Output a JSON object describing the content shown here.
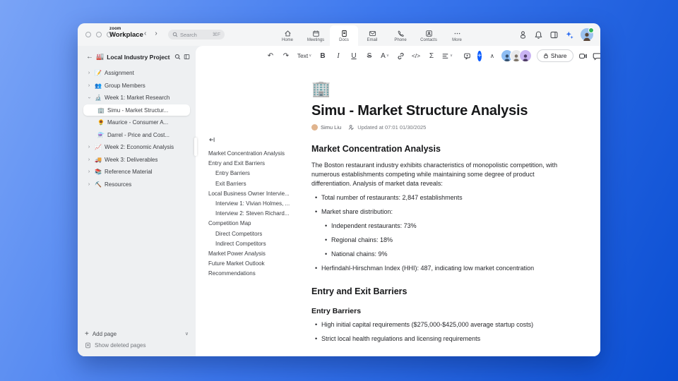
{
  "chrome": {
    "brand_top": "zoom",
    "brand_bottom": "Workplace",
    "back_glyph": "‹",
    "forward_glyph": "›",
    "search_placeholder": "Search",
    "search_shortcut": "⌘F",
    "tabs": [
      {
        "label": "Home"
      },
      {
        "label": "Meetings"
      },
      {
        "label": "Docs"
      },
      {
        "label": "Email"
      },
      {
        "label": "Phone"
      },
      {
        "label": "Contacts"
      },
      {
        "label": "More"
      }
    ]
  },
  "sidebar": {
    "project_icon": "🏭",
    "project_title": "Local Industry Project",
    "items": [
      {
        "icon": "📝",
        "label": "Assignment"
      },
      {
        "icon": "👥",
        "label": "Group Members"
      },
      {
        "icon": "🔬",
        "label": "Week 1: Market Research"
      },
      {
        "icon": "🏢",
        "label": "Simu - Market Structur..."
      },
      {
        "icon": "🌻",
        "label": "Maurice - Consumer A..."
      },
      {
        "icon": "⚗️",
        "label": "Darrel - Price and Cost..."
      },
      {
        "icon": "📈",
        "label": "Week 2: Economic Analysis"
      },
      {
        "icon": "🚚",
        "label": "Week 3: Deliverables"
      },
      {
        "icon": "📚",
        "label": "Reference Material"
      },
      {
        "icon": "⛏️",
        "label": "Resources"
      }
    ],
    "add_page": "Add page",
    "show_deleted": "Show deleted pages"
  },
  "toolbar": {
    "undo_glyph": "↶",
    "redo_glyph": "↷",
    "style_selector": "Text",
    "bold": "B",
    "italic": "I",
    "underline": "U",
    "strike": "S",
    "text_color": "A",
    "code_glyph": "</>",
    "formula_glyph": "Σ",
    "collapse_glyph": "∧",
    "share_label": "Share"
  },
  "outline": {
    "items": [
      {
        "label": "Market Concentration Analysis",
        "level": 1
      },
      {
        "label": "Entry and Exit Barriers",
        "level": 1
      },
      {
        "label": "Entry Barriers",
        "level": 2
      },
      {
        "label": "Exit Barriers",
        "level": 2
      },
      {
        "label": "Local Business Owner Intervie...",
        "level": 1
      },
      {
        "label": "Interview 1: Vivian Holmes, ...",
        "level": 2
      },
      {
        "label": "Interview 2: Steven Richard...",
        "level": 2
      },
      {
        "label": "Competition Map",
        "level": 1
      },
      {
        "label": "Direct Competitors",
        "level": 2
      },
      {
        "label": "Indirect Competitors",
        "level": 2
      },
      {
        "label": "Market Power Analysis",
        "level": 1
      },
      {
        "label": "Future Market Outlook",
        "level": 1
      },
      {
        "label": "Recommendations",
        "level": 1
      }
    ]
  },
  "document": {
    "icon": "🏢",
    "title": "Simu - Market Structure Analysis",
    "author": "Simu Liu",
    "updated": "Updated at 07:01 01/30/2025",
    "blocks": [
      {
        "type": "h2",
        "text": "Market Concentration Analysis"
      },
      {
        "type": "p",
        "text": "The Boston restaurant industry exhibits characteristics of monopolistic competition, with numerous establishments competing while maintaining some degree of product differentiation. Analysis of market data reveals:"
      },
      {
        "type": "li1",
        "text": "Total number of restaurants: 2,847 establishments"
      },
      {
        "type": "li1",
        "text": "Market share distribution:"
      },
      {
        "type": "li2",
        "text": "Independent restaurants: 73%"
      },
      {
        "type": "li2",
        "text": "Regional chains: 18%"
      },
      {
        "type": "li2",
        "text": "National chains: 9%"
      },
      {
        "type": "li1",
        "text": "Herfindahl-Hirschman Index (HHI): 487, indicating low market concentration"
      },
      {
        "type": "h2",
        "text": "Entry and Exit Barriers"
      },
      {
        "type": "h3",
        "text": "Entry Barriers"
      },
      {
        "type": "li1",
        "text": "High initial capital requirements ($275,000-$425,000 average startup costs)"
      },
      {
        "type": "li1",
        "text": "Strict local health regulations and licensing requirements"
      }
    ]
  },
  "colors": {
    "accent": "#0b5cff",
    "background_start": "#7aa4f6",
    "background_end": "#0a4ed2",
    "sidebar_bg": "#eef0f2",
    "selected_item_bg": "#ffffff"
  }
}
